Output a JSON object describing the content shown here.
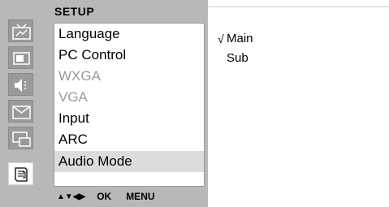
{
  "menu": {
    "title": "SETUP",
    "items": [
      {
        "label": "Language",
        "state": "normal"
      },
      {
        "label": "PC Control",
        "state": "normal"
      },
      {
        "label": "WXGA",
        "state": "disabled"
      },
      {
        "label": "VGA",
        "state": "disabled"
      },
      {
        "label": "Input",
        "state": "normal"
      },
      {
        "label": "ARC",
        "state": "normal"
      },
      {
        "label": "Audio Mode",
        "state": "selected"
      }
    ]
  },
  "side_icons": [
    {
      "name": "tv-picture-icon",
      "active": false
    },
    {
      "name": "screen-icon",
      "active": false
    },
    {
      "name": "speaker-icon",
      "active": false
    },
    {
      "name": "envelope-icon",
      "active": false
    },
    {
      "name": "pip-icon",
      "active": false
    },
    {
      "name": "setup-document-icon",
      "active": true
    }
  ],
  "nav": {
    "arrows": "▲▼◀▶",
    "ok": "OK",
    "menu": "MENU"
  },
  "options": [
    {
      "check": "√",
      "label": "Main",
      "checked": true
    },
    {
      "check": "",
      "label": "Sub",
      "checked": false
    }
  ],
  "colors": {
    "panel": "#b8b8b8",
    "icon_bg": "#9a9a9a",
    "disabled_text": "#9a9a9a",
    "selected_row": "#dcdcdc"
  }
}
